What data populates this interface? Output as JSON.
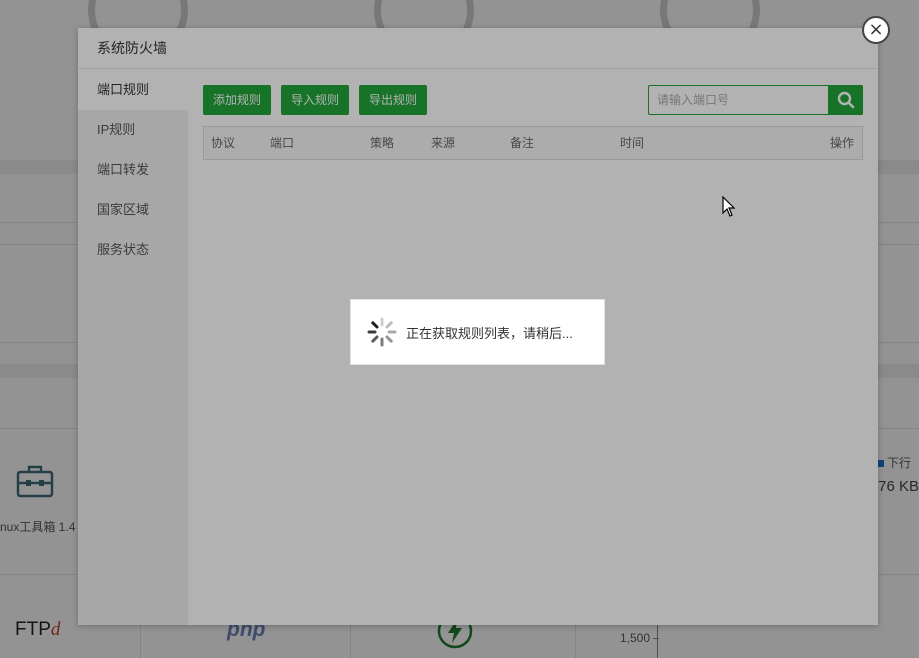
{
  "background": {
    "toolbox_label": "nux工具箱 1.4",
    "legend_label": "下行",
    "traffic_value": ".76 KB",
    "ftp_logo": "FTP",
    "ftp_logo_d": "d",
    "php_logo": "php",
    "axis_tick_label": "1,500"
  },
  "modal": {
    "title": "系统防火墙",
    "close_icon": "close-icon",
    "sidebar": {
      "items": [
        {
          "label": "端口规则",
          "active": true
        },
        {
          "label": "IP规则",
          "active": false
        },
        {
          "label": "端口转发",
          "active": false
        },
        {
          "label": "国家区域",
          "active": false
        },
        {
          "label": "服务状态",
          "active": false
        }
      ]
    },
    "toolbar": {
      "add_label": "添加规则",
      "import_label": "导入规则",
      "export_label": "导出规则"
    },
    "search": {
      "placeholder": "请输入端口号",
      "value": "",
      "icon": "search-icon"
    },
    "table": {
      "columns": [
        "协议",
        "端口",
        "策略",
        "来源",
        "备注",
        "时间",
        "操作"
      ],
      "rows": []
    }
  },
  "loading": {
    "text": "正在获取规则列表，请稍后...",
    "icon": "spinner-icon"
  },
  "colors": {
    "accent": "#20a53a",
    "overlay": "rgba(0,0,0,0.40)"
  }
}
